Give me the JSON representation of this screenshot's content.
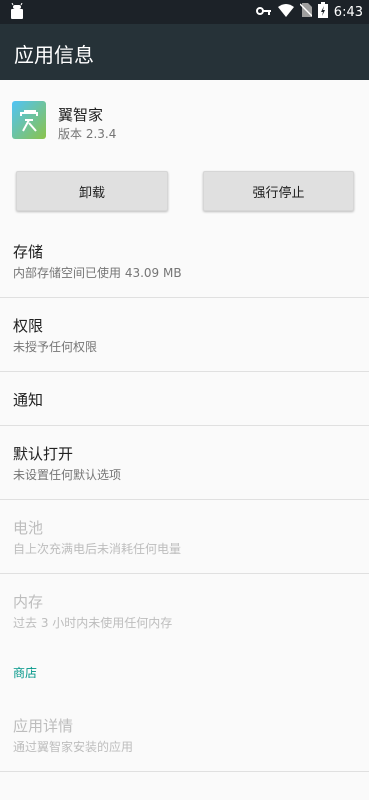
{
  "status_bar": {
    "time": "6:43",
    "icons": [
      "android-icon",
      "key-icon",
      "wifi-icon",
      "no-sim-icon",
      "battery-charging-icon"
    ]
  },
  "app_bar": {
    "title": "应用信息"
  },
  "app": {
    "name": "翼智家",
    "version": "版本 2.3.4"
  },
  "buttons": {
    "uninstall": "卸载",
    "force_stop": "强行停止"
  },
  "rows": {
    "storage": {
      "title": "存储",
      "subtitle": "内部存储空间已使用 43.09 MB"
    },
    "permissions": {
      "title": "权限",
      "subtitle": "未授予任何权限"
    },
    "notifications": {
      "title": "通知"
    },
    "open_by_default": {
      "title": "默认打开",
      "subtitle": "未设置任何默认选项"
    },
    "battery": {
      "title": "电池",
      "subtitle": "自上次充满电后未消耗任何电量"
    },
    "memory": {
      "title": "内存",
      "subtitle": "过去 3 小时内未使用任何内存"
    },
    "store_category": "商店",
    "app_details": {
      "title": "应用详情",
      "subtitle": "通过翼智家安装的应用"
    }
  },
  "colors": {
    "status_bar": "#1c2228",
    "app_bar": "#263238",
    "accent": "#009688"
  }
}
